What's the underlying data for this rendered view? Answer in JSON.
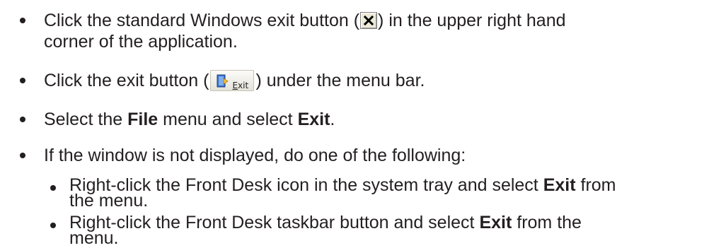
{
  "items": [
    {
      "before": "Click the standard Windows exit button (",
      "icon": "window-close-icon",
      "after_line1": ") in the upper right hand",
      "line2": "corner of the application."
    },
    {
      "before": "Click the exit button (",
      "button": {
        "label_first": "E",
        "label_rest": "xit",
        "icon": "exit-door-icon"
      },
      "after": ") under the menu bar."
    },
    {
      "p1": "Select the ",
      "b1": "File",
      "p2": " menu and select ",
      "b2": "Exit",
      "p3": "."
    },
    {
      "text": "If the window is not displayed, do one of the following:"
    }
  ],
  "subitems": [
    {
      "p1": "Right-click the Front Desk icon in the system tray and select ",
      "b1": "Exit",
      "p2": " from",
      "line2": "the menu."
    },
    {
      "p1": "Right-click the Front Desk taskbar button and select ",
      "b1": "Exit",
      "p2": " from the",
      "line2": "menu."
    }
  ],
  "colors": {
    "text": "#231f20",
    "bullet": "#231f20"
  }
}
